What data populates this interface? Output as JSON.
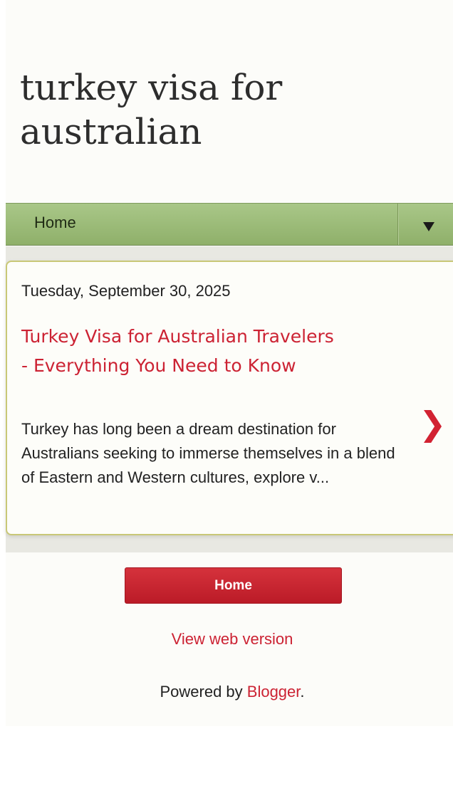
{
  "header": {
    "blog_title": "turkey visa for australian"
  },
  "nav": {
    "home_label": "Home",
    "toggle_icon": "triangle-down-icon"
  },
  "post": {
    "date": "Tuesday, September 30, 2025",
    "title": "Turkey Visa for Australian Travelers - Everything You Need to Know",
    "snippet": "Turkey has long been a dream destination for Australians seeking to immerse themselves in a blend of Eastern and Western cultures, explore v...",
    "arrow_icon": "chevron-right-icon",
    "arrow_glyph": "❯"
  },
  "footer": {
    "home_button_label": "Home",
    "view_web_label": "View web version",
    "powered_prefix": "Powered by ",
    "powered_link": "Blogger",
    "powered_suffix": "."
  },
  "colors": {
    "accent": "#cc2233",
    "nav_green": "#9bbb76",
    "card_border": "#c9c877"
  }
}
